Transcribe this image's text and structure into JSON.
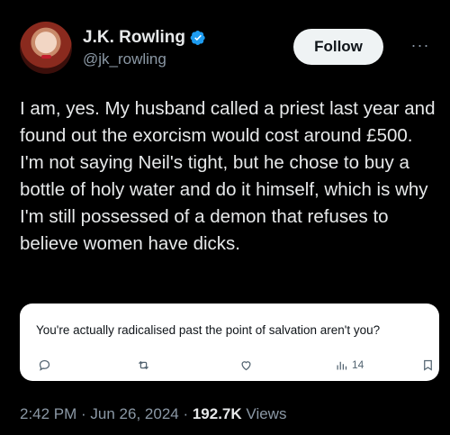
{
  "author": {
    "name": "J.K. Rowling",
    "handle": "@jk_rowling",
    "avatar_icon": "profile-photo"
  },
  "actions": {
    "follow_label": "Follow",
    "more_label": "···"
  },
  "tweet": {
    "text": "I am, yes. My husband called a priest last year and found out the exorcism would cost around £500. I'm not saying Neil's tight, but he chose to buy a bottle of holy water and do it himself, which is why I'm still possessed of a demon that refuses to believe women have dicks."
  },
  "quoted": {
    "text": "You're actually radicalised past the point of salvation aren't you?",
    "views": "14"
  },
  "meta": {
    "time": "2:42 PM",
    "separator": " · ",
    "date": "Jun 26, 2024",
    "views_count": "192.7K",
    "views_label": "Views"
  },
  "colors": {
    "background": "#000000",
    "text": "#e7e9ea",
    "secondary": "#8b98a5",
    "verified": "#1d9bf0"
  }
}
